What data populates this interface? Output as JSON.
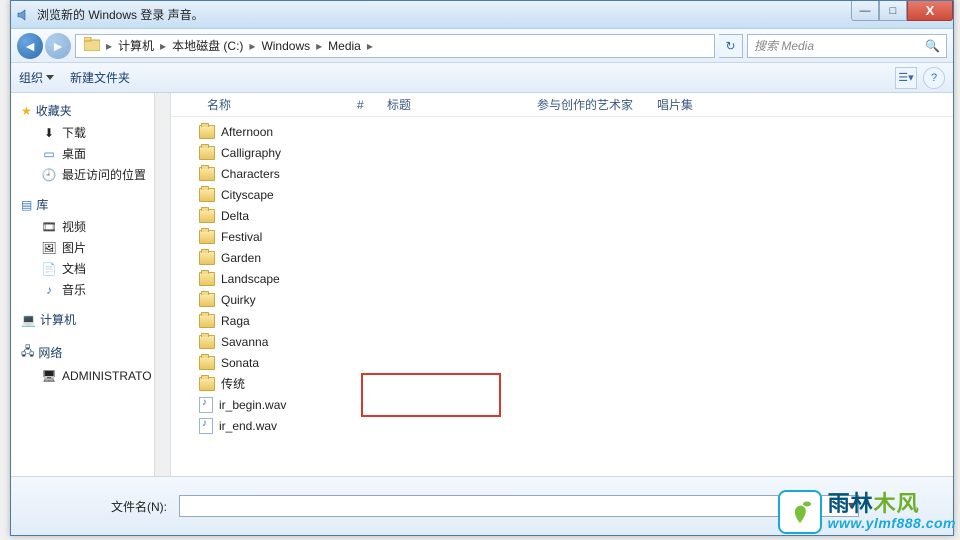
{
  "titlebar": {
    "title": "浏览新的 Windows 登录 声音。"
  },
  "win": {
    "min": "—",
    "max": "□",
    "close": "X"
  },
  "breadcrumb": {
    "segments": [
      "计算机",
      "本地磁盘 (C:)",
      "Windows",
      "Media"
    ]
  },
  "search": {
    "placeholder": "搜索 Media"
  },
  "toolbar": {
    "organize": "组织",
    "newfolder": "新建文件夹"
  },
  "sidebar": {
    "favorites": {
      "label": "收藏夹",
      "items": [
        "下载",
        "桌面",
        "最近访问的位置"
      ]
    },
    "libraries": {
      "label": "库",
      "items": [
        "视频",
        "图片",
        "文档",
        "音乐"
      ]
    },
    "computer": {
      "label": "计算机"
    },
    "network": {
      "label": "网络",
      "items": [
        "ADMINISTRATO"
      ]
    }
  },
  "columns": {
    "name": "名称",
    "num": "#",
    "title": "标题",
    "artist": "参与创作的艺术家",
    "album": "唱片集"
  },
  "folders": [
    "Afternoon",
    "Calligraphy",
    "Characters",
    "Cityscape",
    "Delta",
    "Festival",
    "Garden",
    "Landscape",
    "Quirky",
    "Raga",
    "Savanna",
    "Sonata",
    "传统"
  ],
  "files": [
    "ir_begin.wav",
    "ir_end.wav"
  ],
  "footer": {
    "filename_label": "文件名(N):"
  },
  "watermark": {
    "cn_a": "雨林",
    "cn_b": "木风",
    "url": "www.ylmf888.com"
  }
}
